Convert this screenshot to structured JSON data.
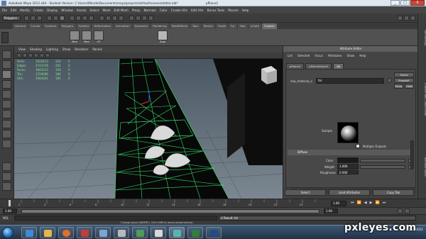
{
  "window": {
    "title": "Autodesk Maya 2012 x64 - Student Version: C:\\Users\\Mende\\Documents\\maya\\projects\\default\\scenes\\dottie.mb*",
    "selection_title": "pPlane3",
    "controls": [
      "_",
      "□",
      "X"
    ]
  },
  "menubar": {
    "items": [
      "File",
      "Edit",
      "Modify",
      "Create",
      "Display",
      "Window",
      "Assets",
      "Select",
      "Mesh",
      "Edit Mesh",
      "Proxy",
      "Normals",
      "Color",
      "Create UVs",
      "Edit UVs",
      "Bonus Tools",
      "Muscle",
      "Help"
    ]
  },
  "statusline": {
    "mode": "Polygons"
  },
  "shelf": {
    "tabs": [
      "General",
      "Curves",
      "Surfaces",
      "Polygons",
      "Subdivs",
      "Deformation",
      "Animation",
      "Dynamics",
      "Rendering",
      "PaintEffects",
      "Toon",
      "Muscle",
      "Fluids",
      "Fur",
      "Hair",
      "nCloth",
      "Custom"
    ],
    "active_tab": "Custom",
    "items": [
      {
        "label": "Mod"
      },
      {
        "label": "Mod"
      },
      {
        "label": "CP"
      },
      {
        "label": "Dupl"
      }
    ]
  },
  "viewport": {
    "menu": [
      "View",
      "Shading",
      "Lighting",
      "Show",
      "Renderer",
      "Panels"
    ],
    "hud": [
      {
        "label": "Verts:",
        "v1": "1922413",
        "v2": "142",
        "v3": "0"
      },
      {
        "label": "Edges:",
        "v1": "3743728",
        "v2": "291",
        "v3": "0"
      },
      {
        "label": "Faces:",
        "v1": "1843313",
        "v2": "150",
        "v3": "0"
      },
      {
        "label": "Tris:",
        "v1": "3704096",
        "v2": "184",
        "v3": "0"
      },
      {
        "label": "UVs:",
        "v1": "1944161",
        "v2": "181",
        "v3": "0"
      }
    ],
    "colors": {
      "background": "#55626d",
      "wire": "#36e06a",
      "plane": "#080808"
    }
  },
  "attribute_editor": {
    "header": "Attribute Editor",
    "menu": [
      "List",
      "Selected",
      "Focus",
      "Attributes",
      "Show",
      "Help"
    ],
    "tabs": [
      "pPlane3",
      "pPlaneShape3",
      "fol"
    ],
    "active_tab": "fol",
    "material_label": "mia_material_x:",
    "material_value": "fol",
    "focus_button": "Focus",
    "presets_button": "Presets*",
    "show_button": "Show",
    "hide_button": "Hide",
    "sample_label": "Sample",
    "multiple_outputs_label": "Multiple Outputs",
    "diffuse_header": "Diffuse",
    "fields": [
      {
        "label": "Color",
        "value": ""
      },
      {
        "label": "Weight",
        "value": "1.000"
      },
      {
        "label": "Roughness",
        "value": "0.000"
      }
    ],
    "notes_label": "Notes: fol",
    "buttons": [
      "Select",
      "Load Attributes",
      "Copy Tab"
    ]
  },
  "side_tabs": [
    "Tool Settings",
    "Channel Box / Layer Editor",
    "Attribute Editor"
  ],
  "timeline": {
    "ticks": [
      "2",
      "4",
      "6",
      "8",
      "10",
      "12",
      "14",
      "16",
      "18",
      "20",
      "22",
      "24"
    ],
    "current": "1.00"
  },
  "range": {
    "start": "1.00",
    "end": "1.00"
  },
  "command_line": {
    "lang": "MEL",
    "result": "// Result: fol"
  },
  "help_line": "Change pivot (INSERT), Ctrl+LMB to move perpendicular.",
  "taskbar": {
    "time": "",
    "date": "30/11/2011"
  },
  "watermark": "pxleyes.com"
}
